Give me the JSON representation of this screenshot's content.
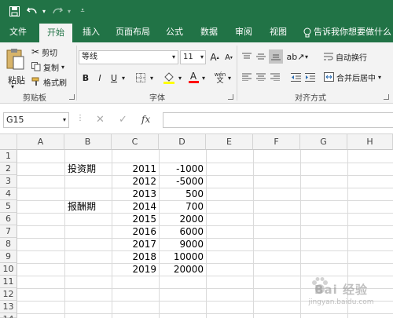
{
  "quick_access": {
    "save_icon": "save-icon",
    "undo_icon": "undo-icon",
    "redo_icon": "redo-icon",
    "customize_icon": "customize-icon"
  },
  "menu": {
    "tabs": [
      "文件",
      "开始",
      "插入",
      "页面布局",
      "公式",
      "数据",
      "审阅",
      "视图"
    ],
    "active_tab": "开始",
    "tell_me": "告诉我你想要做什么"
  },
  "ribbon": {
    "clipboard": {
      "paste": "粘贴",
      "cut": "剪切",
      "copy": "复制",
      "format_painter": "格式刷",
      "label": "剪贴板"
    },
    "font": {
      "name": "等线",
      "size": "11",
      "grow": "A",
      "shrink": "A",
      "bold": "B",
      "italic": "I",
      "underline": "U",
      "font_color": "A",
      "phonetic": "wén",
      "label": "字体"
    },
    "alignment": {
      "wrap_text": "自动换行",
      "merge_center": "合并后居中",
      "label": "对齐方式"
    }
  },
  "formula_bar": {
    "name_box": "G15",
    "fx": "fx",
    "formula": ""
  },
  "sheet": {
    "columns": [
      "A",
      "B",
      "C",
      "D",
      "E",
      "F",
      "G",
      "H"
    ],
    "rows": [
      "1",
      "2",
      "3",
      "4",
      "5",
      "6",
      "7",
      "8",
      "9",
      "10",
      "11",
      "12",
      "13",
      "14"
    ],
    "cells": {
      "b2": "投资期",
      "b5": "报酬期",
      "c": [
        "2011",
        "2012",
        "2013",
        "2014",
        "2015",
        "2016",
        "2017",
        "2018",
        "2019"
      ],
      "d": [
        "-1000",
        "-5000",
        "500",
        "700",
        "2000",
        "6000",
        "9000",
        "10000",
        "20000"
      ]
    }
  },
  "watermark": {
    "text": "Bai 经验",
    "sub": "jingyan.baidu.com"
  }
}
